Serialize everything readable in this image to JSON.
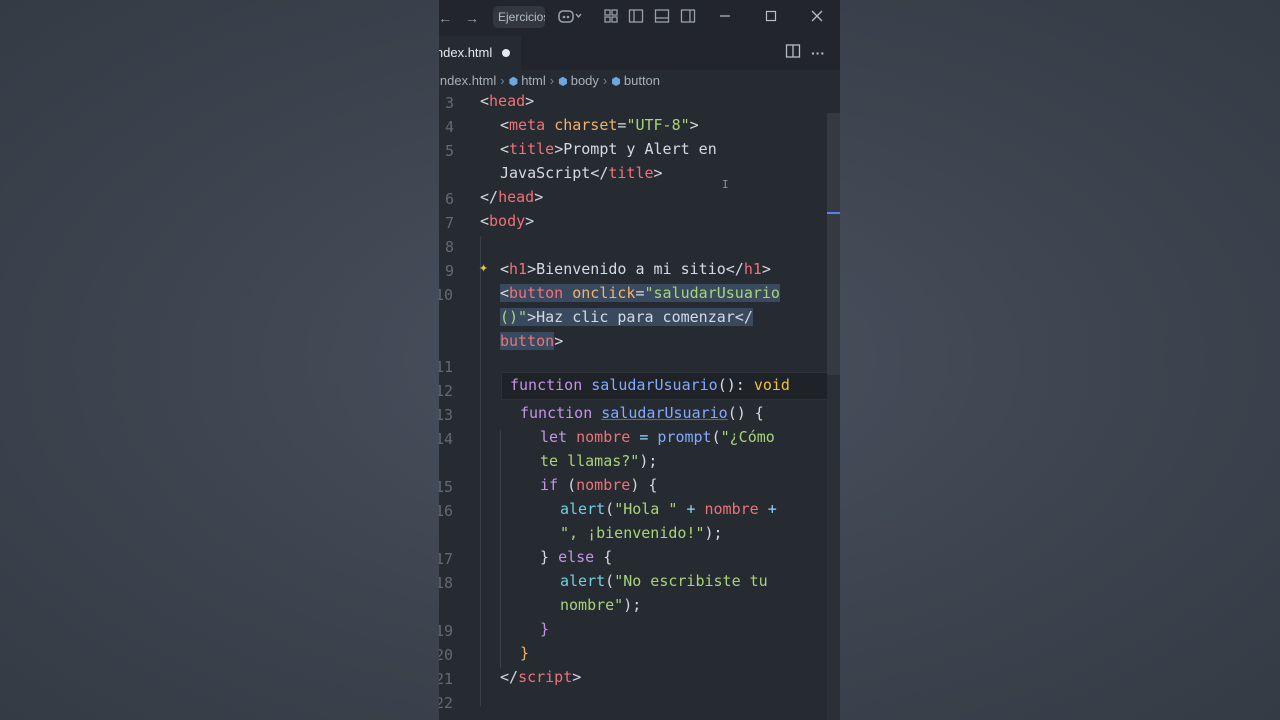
{
  "titlebar": {
    "search_label": "Ejercicios",
    "icons": [
      "arrow-left-icon",
      "arrow-right-icon",
      "copilot-icon",
      "layout-icon",
      "sidebar-left-icon",
      "panel-icon",
      "sidebar-right-icon",
      "minimize-icon",
      "maximize-icon",
      "close-icon"
    ]
  },
  "tab": {
    "label": "index.html",
    "modified": true
  },
  "tab_actions": {
    "split": "split-editor-icon",
    "more": "more-actions-icon"
  },
  "breadcrumb": {
    "file": "index.html",
    "items": [
      "html",
      "body",
      "button"
    ]
  },
  "line_numbers": [
    "3",
    "4",
    "5",
    "6",
    "7",
    "8",
    "9",
    "10",
    "11",
    "12",
    "13",
    "14",
    "15",
    "16",
    "17",
    "18",
    "19",
    "20",
    "21",
    "22"
  ],
  "hover": {
    "text_keyword": "function",
    "text_name": "saludarUsuario",
    "text_sig": "(): ",
    "text_type": "void"
  },
  "code": {
    "l3_tag": "head",
    "l4_tag": "meta",
    "l4_attr": "charset",
    "l4_val": "\"UTF-8\"",
    "l5_tag": "title",
    "l5_text": "Prompt y Alert en",
    "l5b_text": "JavaScript",
    "l5b_close": "title",
    "l6_tag": "head",
    "l7_tag": "body",
    "l9_tag": "h1",
    "l9_text": "Bienvenido a mi sitio",
    "l9_close": "h1",
    "l10_tag": "button",
    "l10_attr": "onclick",
    "l10_val1": "\"saludarUsuario",
    "l10_val2": "()\"",
    "l10_text": "Haz clic para comenzar</",
    "l10_close": "button",
    "l13_kw": "function",
    "l13_fn": "saludarUsuario",
    "l13_rest": "() {",
    "l14_kw": "let",
    "l14_var": "nombre",
    "l14_fn": "prompt",
    "l14_str": "\"¿Cómo",
    "l14b_str": "te llamas?\"",
    "l15_kw": "if",
    "l15_var": "nombre",
    "l16_fn": "alert",
    "l16_str": "\"Hola \"",
    "l16_var": "nombre",
    "l16b_str": "\", ¡bienvenido!\"",
    "l17_kw": "else",
    "l18_fn": "alert",
    "l18_str": "\"No escribiste tu",
    "l18b_str": "nombre\"",
    "l21_tag": "script"
  }
}
